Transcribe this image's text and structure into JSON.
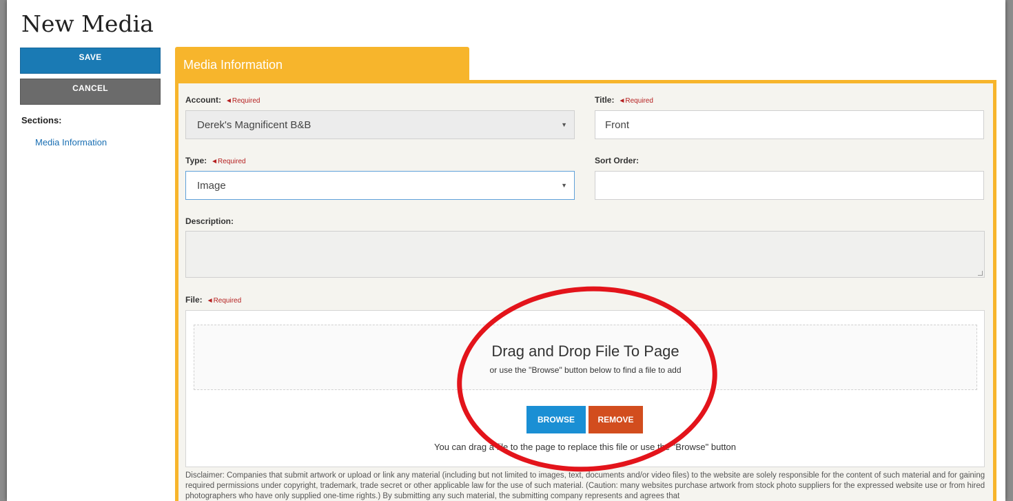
{
  "page_title": "New Media",
  "sidebar": {
    "save_label": "SAVE",
    "cancel_label": "CANCEL",
    "sections_label": "Sections:",
    "sections": [
      "Media Information"
    ]
  },
  "tab": {
    "label": "Media Information"
  },
  "form": {
    "required_text": "◄Required",
    "account": {
      "label": "Account:",
      "value": "Derek's Magnificent B&B"
    },
    "title": {
      "label": "Title:",
      "value": "Front"
    },
    "type": {
      "label": "Type:",
      "value": "Image"
    },
    "sort_order": {
      "label": "Sort Order:",
      "value": ""
    },
    "description": {
      "label": "Description:",
      "value": ""
    },
    "file": {
      "label": "File:",
      "drop_title": "Drag and Drop File To Page",
      "drop_sub": "or use the \"Browse\" button below to find a file to add",
      "browse_label": "BROWSE",
      "remove_label": "REMOVE",
      "hint": "You can drag a file to the page to replace this file or use the \"Browse\" button"
    },
    "disclaimer": "Disclaimer: Companies that submit artwork or upload or link any material (including but not limited to images, text, documents and/or video files) to the website are solely responsible for the content of such material and for gaining required permissions under copyright, trademark, trade secret or other applicable law for the use of such material. (Caution: many websites purchase artwork from stock photo suppliers for the expressed website use or from hired photographers who have only supplied one-time rights.) By submitting any such material, the submitting company represents and agrees that"
  },
  "colors": {
    "accent": "#f7b52c",
    "save": "#1a7ab4",
    "cancel": "#6b6b6b",
    "browse": "#1a8fd4",
    "remove": "#d24d1e",
    "required": "#b52020",
    "highlight": "#e3141b"
  }
}
